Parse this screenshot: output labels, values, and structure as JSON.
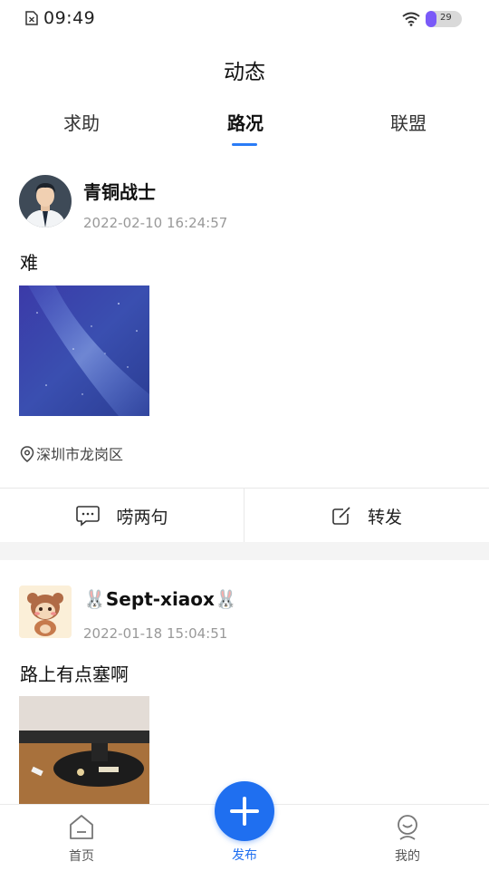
{
  "status_bar": {
    "time": "09:49",
    "battery": "29",
    "battery_level": 0.29
  },
  "page_title": "动态",
  "tabs": [
    {
      "label": "求助",
      "active": false
    },
    {
      "label": "路况",
      "active": true
    },
    {
      "label": "联盟",
      "active": false
    }
  ],
  "posts": [
    {
      "username": "青铜战士",
      "timestamp": "2022-02-10 16:24:57",
      "content": "难",
      "location": "深圳市龙岗区"
    },
    {
      "username": "🐰Sept-xiaox🐰",
      "timestamp": "2022-01-18 15:04:51",
      "content": "路上有点塞啊"
    }
  ],
  "actions": {
    "comment": "唠两句",
    "forward": "转发"
  },
  "bottom_nav": {
    "home": "首页",
    "publish": "发布",
    "mine": "我的"
  },
  "colors": {
    "accent": "#1f6ff0",
    "tab_underline": "#2a7cf6"
  }
}
